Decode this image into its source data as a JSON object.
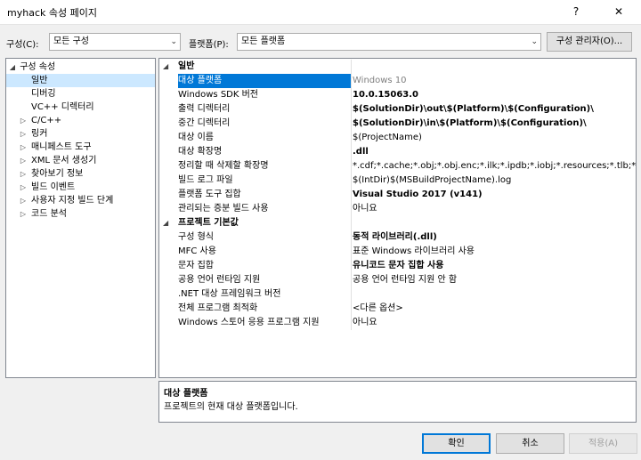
{
  "window": {
    "title": "myhack 속성 페이지",
    "help": "?",
    "close": "✕"
  },
  "config": {
    "config_label": "구성(C):",
    "config_value": "모든 구성",
    "platform_label": "플랫폼(P):",
    "platform_value": "모든 플랫폼",
    "manager_button": "구성 관리자(O)..."
  },
  "tree": {
    "root": "구성 속성",
    "items": [
      {
        "label": "일반",
        "selected": true,
        "expander": ""
      },
      {
        "label": "디버깅",
        "expander": ""
      },
      {
        "label": "VC++ 디렉터리",
        "expander": ""
      },
      {
        "label": "C/C++",
        "expander": "▷"
      },
      {
        "label": "링커",
        "expander": "▷"
      },
      {
        "label": "매니페스트 도구",
        "expander": "▷"
      },
      {
        "label": "XML 문서 생성기",
        "expander": "▷"
      },
      {
        "label": "찾아보기 정보",
        "expander": "▷"
      },
      {
        "label": "빌드 이벤트",
        "expander": "▷"
      },
      {
        "label": "사용자 지정 빌드 단계",
        "expander": "▷"
      },
      {
        "label": "코드 분석",
        "expander": "▷"
      }
    ]
  },
  "grid": {
    "general": {
      "category": "일반",
      "rows": [
        {
          "name": "대상 플랫폼",
          "value": "Windows 10"
        },
        {
          "name": "Windows SDK 버전",
          "value": "10.0.15063.0"
        },
        {
          "name": "출력 디렉터리",
          "value": "$(SolutionDir)\\out\\$(Platform)\\$(Configuration)\\"
        },
        {
          "name": "중간 디렉터리",
          "value": "$(SolutionDir)\\in\\$(Platform)\\$(Configuration)\\"
        },
        {
          "name": "대상 이름",
          "value": "$(ProjectName)"
        },
        {
          "name": "대상 확장명",
          "value": ".dll"
        },
        {
          "name": "정리할 때 삭제할 확장명",
          "value": "*.cdf;*.cache;*.obj;*.obj.enc;*.ilk;*.ipdb;*.iobj;*.resources;*.tlb;*.tli;*.tlh;*.t"
        },
        {
          "name": "빌드 로그 파일",
          "value": "$(IntDir)$(MSBuildProjectName).log"
        },
        {
          "name": "플랫폼 도구 집합",
          "value": "Visual Studio 2017 (v141)"
        },
        {
          "name": "관리되는 증분 빌드 사용",
          "value": "아니요"
        }
      ]
    },
    "defaults": {
      "category": "프로젝트 기본값",
      "rows": [
        {
          "name": "구성 형식",
          "value": "동적 라이브러리(.dll)"
        },
        {
          "name": "MFC 사용",
          "value": "표준 Windows 라이브러리 사용"
        },
        {
          "name": "문자 집합",
          "value": "유니코드 문자 집합 사용"
        },
        {
          "name": "공용 언어 런타임 지원",
          "value": "공용 언어 런타임 지원 안 함"
        },
        {
          "name": ".NET 대상 프레임워크 버전",
          "value": ""
        },
        {
          "name": "전체 프로그램 최적화",
          "value": "<다른 옵션>"
        },
        {
          "name": "Windows 스토어 응용 프로그램 지원",
          "value": "아니요"
        }
      ]
    }
  },
  "description": {
    "title": "대상 플랫폼",
    "text": "프로젝트의 현재 대상 플랫폼입니다."
  },
  "buttons": {
    "ok": "확인",
    "cancel": "취소",
    "apply": "적용(A)"
  },
  "colors": {
    "selection": "#0078d7",
    "tree_selection": "#cce8ff"
  }
}
